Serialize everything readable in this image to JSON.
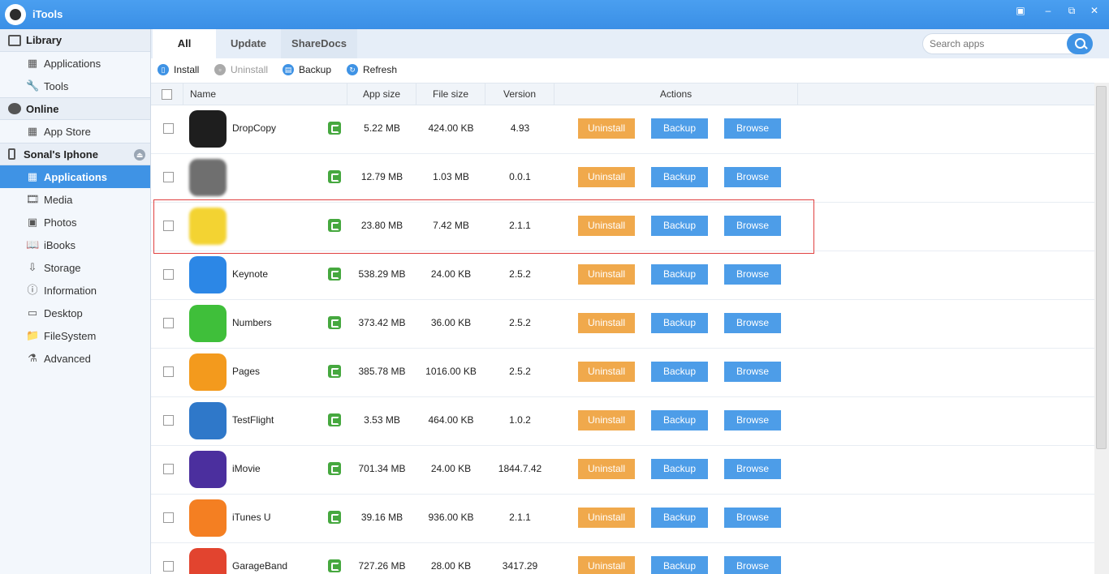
{
  "app": {
    "title": "iTools"
  },
  "window": {
    "minimize_icon": "minimize-icon",
    "restore_icon": "restore-icon",
    "close_icon": "close-icon"
  },
  "sidebar": {
    "library": {
      "label": "Library",
      "items": [
        {
          "label": "Applications",
          "icon": "grid-icon"
        },
        {
          "label": "Tools",
          "icon": "wrench-icon"
        }
      ]
    },
    "online": {
      "label": "Online",
      "items": [
        {
          "label": "App Store",
          "icon": "grid-icon"
        }
      ]
    },
    "device": {
      "label": "Sonal's Iphone",
      "items": [
        {
          "label": "Applications",
          "icon": "grid-icon",
          "active": true
        },
        {
          "label": "Media",
          "icon": "film-icon"
        },
        {
          "label": "Photos",
          "icon": "photo-icon"
        },
        {
          "label": "iBooks",
          "icon": "book-icon"
        },
        {
          "label": "Storage",
          "icon": "storage-icon"
        },
        {
          "label": "Information",
          "icon": "info-icon"
        },
        {
          "label": "Desktop",
          "icon": "desktop-icon"
        },
        {
          "label": "FileSystem",
          "icon": "folder-icon"
        },
        {
          "label": "Advanced",
          "icon": "flask-icon"
        }
      ]
    }
  },
  "tabs": [
    {
      "label": "All",
      "active": true
    },
    {
      "label": "Update"
    },
    {
      "label": "ShareDocs"
    }
  ],
  "search": {
    "placeholder": "Search apps"
  },
  "toolbar": {
    "install": "Install",
    "uninstall": "Uninstall",
    "backup": "Backup",
    "refresh": "Refresh"
  },
  "table": {
    "headers": {
      "name": "Name",
      "app_size": "App size",
      "file_size": "File size",
      "version": "Version",
      "actions": "Actions"
    },
    "action_labels": {
      "uninstall": "Uninstall",
      "backup": "Backup",
      "browse": "Browse"
    },
    "rows": [
      {
        "name": "DropCopy",
        "app_size": "5.22 MB",
        "file_size": "424.00 KB",
        "version": "4.93",
        "icon_color": "#1e1e1e"
      },
      {
        "name": "",
        "app_size": "12.79 MB",
        "file_size": "1.03 MB",
        "version": "0.0.1",
        "icon_color": "#6f6f6f",
        "blurred": true
      },
      {
        "name": "",
        "app_size": "23.80 MB",
        "file_size": "7.42 MB",
        "version": "2.1.1",
        "icon_color": "#f3d332",
        "blurred": true
      },
      {
        "name": "Keynote",
        "app_size": "538.29 MB",
        "file_size": "24.00 KB",
        "version": "2.5.2",
        "icon_color": "#2c87e6"
      },
      {
        "name": "Numbers",
        "app_size": "373.42 MB",
        "file_size": "36.00 KB",
        "version": "2.5.2",
        "icon_color": "#3fbf3a"
      },
      {
        "name": "Pages",
        "app_size": "385.78 MB",
        "file_size": "1016.00 KB",
        "version": "2.5.2",
        "icon_color": "#f39a1d"
      },
      {
        "name": "TestFlight",
        "app_size": "3.53 MB",
        "file_size": "464.00 KB",
        "version": "1.0.2",
        "icon_color": "#2f78c9"
      },
      {
        "name": "iMovie",
        "app_size": "701.34 MB",
        "file_size": "24.00 KB",
        "version": "1844.7.42",
        "icon_color": "#4b2f9e"
      },
      {
        "name": "iTunes U",
        "app_size": "39.16 MB",
        "file_size": "936.00 KB",
        "version": "2.1.1",
        "icon_color": "#f47f22"
      },
      {
        "name": "GarageBand",
        "app_size": "727.26 MB",
        "file_size": "28.00 KB",
        "version": "3417.29",
        "icon_color": "#e2442f"
      }
    ]
  }
}
